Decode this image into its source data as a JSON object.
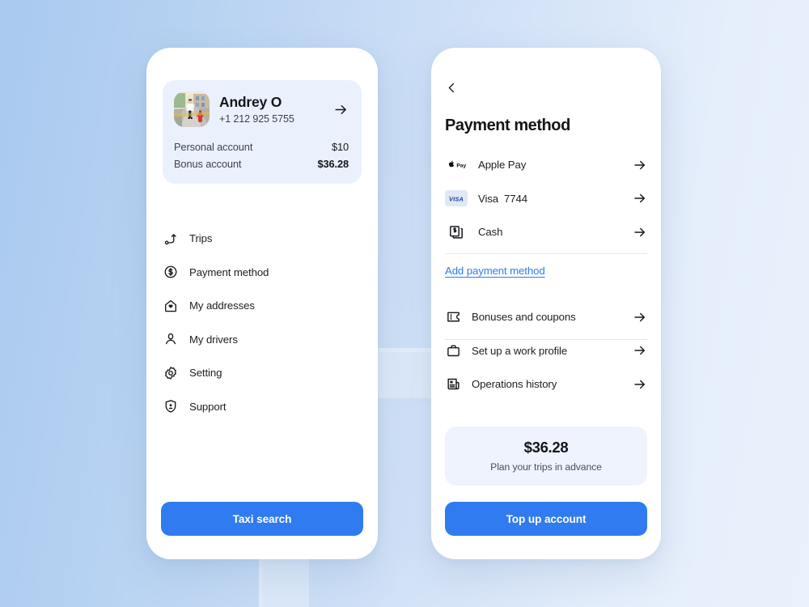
{
  "theme": {
    "accent": "#2f7bef",
    "card_bg": "#ffffff",
    "profile_card_bg": "#eaf1fd",
    "balance_card_bg": "#eef3fd",
    "text_primary": "#14161a",
    "text_secondary": "#4a4f56",
    "background_gradient_from": "#a9c9ef",
    "background_gradient_to": "#eaf1fc"
  },
  "left_screen": {
    "profile": {
      "name": "Andrey O",
      "phone": "+1 212 925 5755",
      "avatar_icon": "user-photo",
      "chevron_icon": "arrow-right-icon",
      "accounts": [
        {
          "label": "Personal account",
          "value": "$10",
          "bold": false
        },
        {
          "label": "Bonus account",
          "value": "$36.28",
          "bold": true
        }
      ]
    },
    "menu": [
      {
        "label": "Trips",
        "icon": "route-icon"
      },
      {
        "label": "Payment method",
        "icon": "dollar-circle-icon"
      },
      {
        "label": "My addresses",
        "icon": "home-icon"
      },
      {
        "label": "My drivers",
        "icon": "person-icon"
      },
      {
        "label": "Setting",
        "icon": "gear-icon"
      },
      {
        "label": "Support",
        "icon": "shield-person-icon"
      }
    ],
    "primary_button": "Taxi search"
  },
  "right_screen": {
    "back_icon": "chevron-left-icon",
    "title": "Payment method",
    "payment_methods": [
      {
        "label": "Apple Pay",
        "number": "",
        "badge": "apple-pay-logo",
        "arrow": "arrow-right-icon"
      },
      {
        "label": "Visa",
        "number": "7744",
        "badge": "visa-logo",
        "arrow": "arrow-right-icon"
      },
      {
        "label": "Cash",
        "number": "",
        "badge": "cash-icon",
        "arrow": "arrow-right-icon"
      }
    ],
    "add_payment_link": "Add payment method",
    "extras": [
      {
        "label": "Bonuses and coupons",
        "icon": "ticket-icon",
        "arrow": "arrow-right-icon"
      },
      {
        "label": "Set up a work profile",
        "icon": "briefcase-icon",
        "arrow": "arrow-right-icon"
      },
      {
        "label": "Operations history",
        "icon": "receipt-icon",
        "arrow": "arrow-right-icon"
      }
    ],
    "balance": {
      "amount": "$36.28",
      "subtitle": "Plan your trips in advance"
    },
    "primary_button": "Top up account"
  }
}
